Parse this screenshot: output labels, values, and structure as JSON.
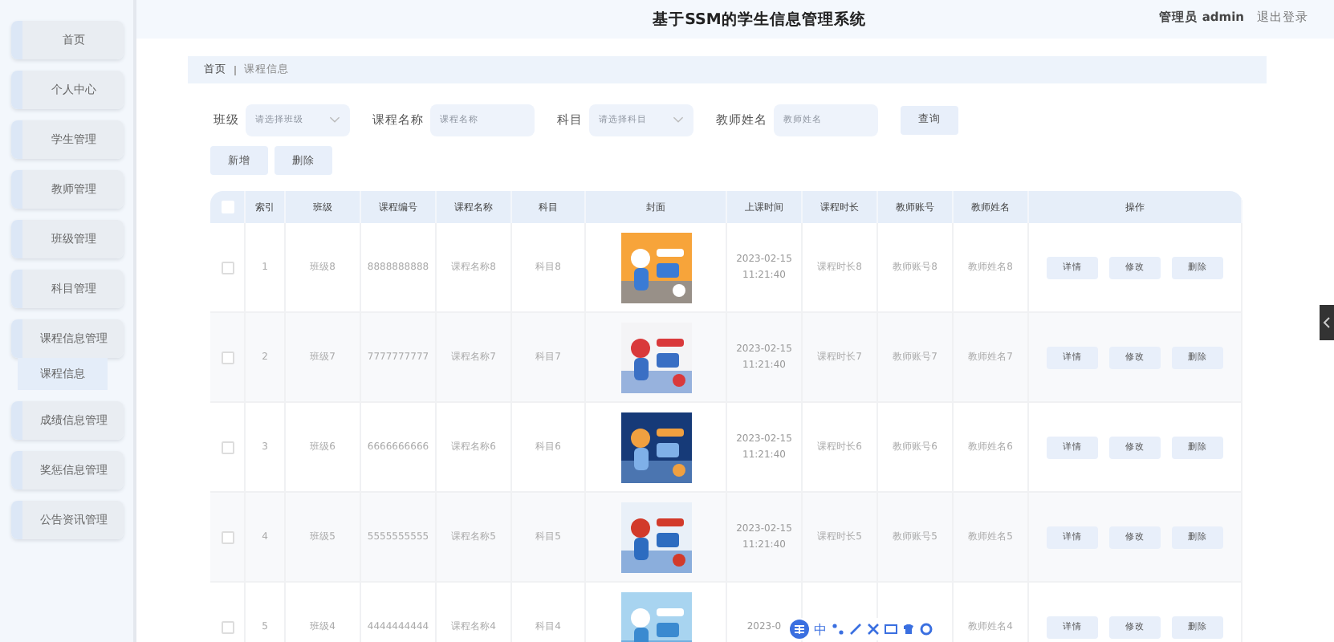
{
  "header": {
    "title": "基于SSM的学生信息管理系统",
    "user": "管理员 admin",
    "logout": "退出登录"
  },
  "sidebar": {
    "items": [
      {
        "label": "首页"
      },
      {
        "label": "个人中心"
      },
      {
        "label": "学生管理"
      },
      {
        "label": "教师管理"
      },
      {
        "label": "班级管理"
      },
      {
        "label": "科目管理"
      },
      {
        "label": "课程信息管理",
        "children": [
          {
            "label": "课程信息",
            "selected": true
          }
        ]
      },
      {
        "label": "成绩信息管理"
      },
      {
        "label": "奖惩信息管理"
      },
      {
        "label": "公告资讯管理"
      }
    ]
  },
  "breadcrumb": [
    "首页",
    "课程信息"
  ],
  "filters": [
    {
      "label": "班级",
      "kind": "select",
      "placeholder": "请选择班级"
    },
    {
      "label": "课程名称",
      "kind": "input",
      "placeholder": "课程名称"
    },
    {
      "label": "科目",
      "kind": "select",
      "placeholder": "请选择科目"
    },
    {
      "label": "教师姓名",
      "kind": "input",
      "placeholder": "教师姓名"
    }
  ],
  "search_button": "查询",
  "actions": [
    "新增",
    "删除"
  ],
  "table": {
    "select_all": {
      "checked": false
    },
    "columns": [
      "索引",
      "班级",
      "课程编号",
      "课程名称",
      "科目",
      "封面",
      "上课时间",
      "课程时长",
      "教师账号",
      "教师姓名",
      "操作"
    ],
    "rows": [
      {
        "checked": false,
        "index": "1",
        "class": "班级8",
        "code": "8888888888",
        "name": "课程名称8",
        "subject": "科目8",
        "time": [
          "2023-02-15",
          "11:21:40"
        ],
        "duration": "课程时长8",
        "account": "教师账号8",
        "teacher": "教师姓名8",
        "buttons": [
          "详情",
          "修改",
          "删除"
        ]
      },
      {
        "checked": false,
        "index": "2",
        "class": "班级7",
        "code": "7777777777",
        "name": "课程名称7",
        "subject": "科目7",
        "time": [
          "2023-02-15",
          "11:21:40"
        ],
        "duration": "课程时长7",
        "account": "教师账号7",
        "teacher": "教师姓名7",
        "buttons": [
          "详情",
          "修改",
          "删除"
        ]
      },
      {
        "checked": false,
        "index": "3",
        "class": "班级6",
        "code": "6666666666",
        "name": "课程名称6",
        "subject": "科目6",
        "time": [
          "2023-02-15",
          "11:21:40"
        ],
        "duration": "课程时长6",
        "account": "教师账号6",
        "teacher": "教师姓名6",
        "buttons": [
          "详情",
          "修改",
          "删除"
        ]
      },
      {
        "checked": false,
        "index": "4",
        "class": "班级5",
        "code": "5555555555",
        "name": "课程名称5",
        "subject": "科目5",
        "time": [
          "2023-02-15",
          "11:21:40"
        ],
        "duration": "课程时长5",
        "account": "教师账号5",
        "teacher": "教师姓名5",
        "buttons": [
          "详情",
          "修改",
          "删除"
        ]
      },
      {
        "checked": false,
        "index": "5",
        "class": "班级4",
        "code": "4444444444",
        "name": "课程名称4",
        "subject": "科目4",
        "time": [
          "2023-0"
        ],
        "teacher": "教师姓名4",
        "buttons": [
          "详情",
          "修改",
          "删除"
        ]
      }
    ]
  },
  "ime_toolbar": {
    "label": "中"
  }
}
